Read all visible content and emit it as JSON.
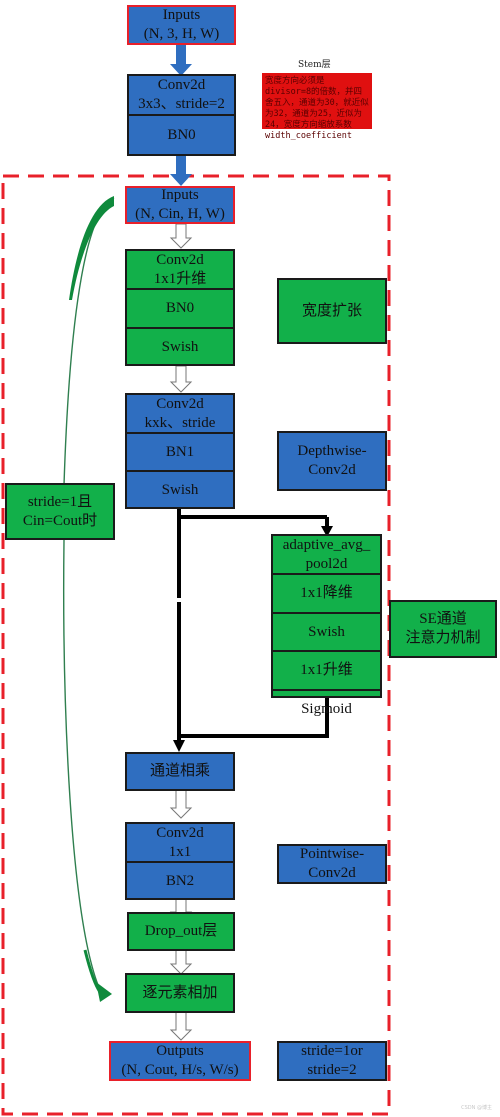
{
  "stem": {
    "inputs": {
      "line1": "Inputs",
      "line2": "(N, 3, H, W)"
    },
    "conv": {
      "line1": "Conv2d",
      "line2": "3x3、stride=2"
    },
    "bn": "BN0",
    "label": "Stem层",
    "note": "宽度方向必须是divisor=8的倍数，并四舍五入，通道为30，就近似为32，通道为25，近似为24，宽度方向缩放系数width_coefficient"
  },
  "mbconv": {
    "inputs": {
      "line1": "Inputs",
      "line2": "(N, Cin, H, W)"
    },
    "expand": {
      "conv": {
        "line1": "Conv2d",
        "line2": "1x1升维"
      },
      "bn": "BN0",
      "act": "Swish",
      "label": "宽度扩张"
    },
    "depthwise": {
      "conv": {
        "line1": "Conv2d",
        "line2": "kxk、stride"
      },
      "bn": "BN1",
      "act": "Swish",
      "label": {
        "line1": "Depthwise-",
        "line2": "Conv2d"
      }
    },
    "se": {
      "pool": {
        "line1": "adaptive_avg_",
        "line2": "pool2d"
      },
      "reduce": "1x1降维",
      "act": "Swish",
      "expand": "1x1升维",
      "gate": "Sigmoid",
      "label": {
        "line1": "SE通道",
        "line2": "注意力机制"
      }
    },
    "multiply": "通道相乘",
    "pointwise": {
      "conv": {
        "line1": "Conv2d",
        "line2": "1x1"
      },
      "bn": "BN2",
      "label": {
        "line1": "Pointwise-",
        "line2": "Conv2d"
      }
    },
    "dropout": "Drop_out层",
    "add": "逐元素相加",
    "shortcut_condition": {
      "line1": "stride=1且",
      "line2": "Cin=Cout时"
    },
    "outputs": {
      "line1": "Outputs",
      "line2": "(N, Cout, H/s, W/s)"
    },
    "stride_note": {
      "line1": "stride=1or",
      "line2": "stride=2"
    }
  },
  "colors": {
    "blue": "#2f6ec0",
    "green": "#12b04a",
    "red": "#e8202a",
    "note_red": "#e01010",
    "arrow_green": "#0f8a3c"
  },
  "watermark": "CSDN @博主"
}
